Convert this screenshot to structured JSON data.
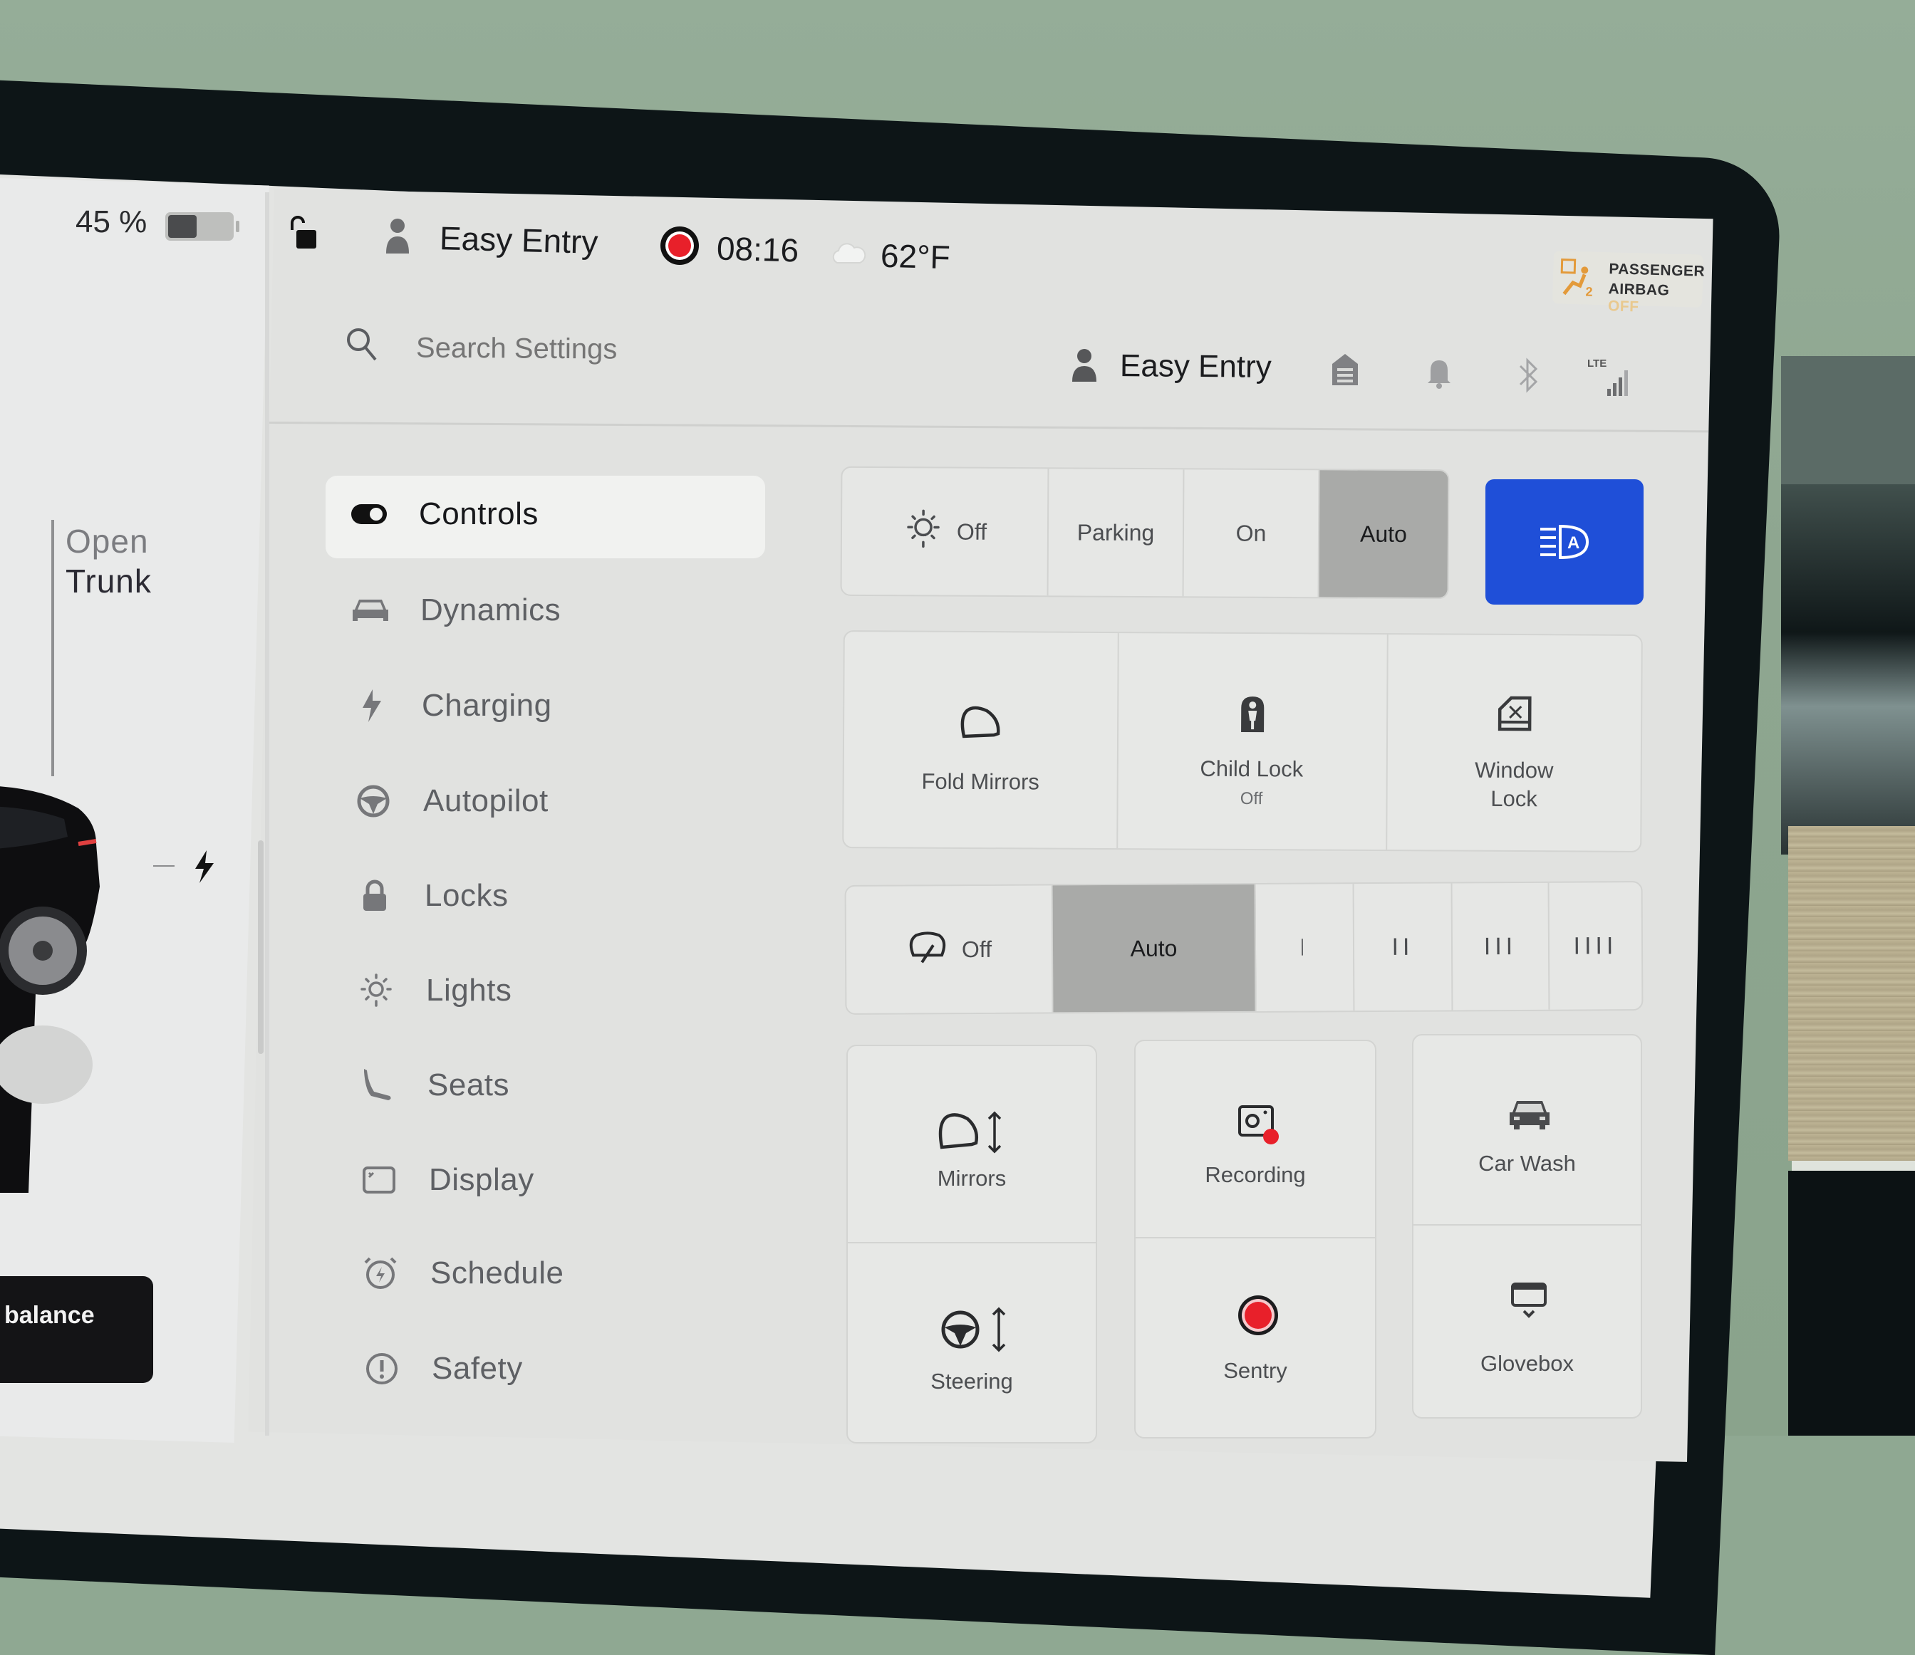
{
  "status_bar": {
    "battery_percent_label": "45 %",
    "battery_level": 0.45,
    "lock_state": "unlocked",
    "driver_profile": "Easy Entry",
    "recording_indicator": "recording",
    "time": "08:16",
    "weather_icon": "cloud-icon",
    "temperature": "62°F",
    "airbag_badge": {
      "line1": "PASSENGER",
      "line2": "AIRBAG",
      "state": "OFF"
    }
  },
  "car_panel": {
    "open_trunk_line1": "Open",
    "open_trunk_line2": "Trunk",
    "charge_port_icon": "lightning-icon",
    "toast_text": "balance"
  },
  "search": {
    "placeholder": "Search Settings"
  },
  "header_right": {
    "profile_name": "Easy Entry",
    "icons": [
      "garage-icon",
      "bell-icon",
      "bluetooth-icon",
      "lte-signal-icon"
    ],
    "lte_label": "LTE"
  },
  "sidebar": {
    "active": "Controls",
    "items": [
      {
        "label": "Controls",
        "icon": "toggle-icon"
      },
      {
        "label": "Dynamics",
        "icon": "car-icon"
      },
      {
        "label": "Charging",
        "icon": "lightning-icon"
      },
      {
        "label": "Autopilot",
        "icon": "steering-wheel-icon"
      },
      {
        "label": "Locks",
        "icon": "lock-icon"
      },
      {
        "label": "Lights",
        "icon": "bulb-icon"
      },
      {
        "label": "Seats",
        "icon": "seat-icon"
      },
      {
        "label": "Display",
        "icon": "display-icon"
      },
      {
        "label": "Schedule",
        "icon": "alarm-clock-icon"
      },
      {
        "label": "Safety",
        "icon": "alert-icon"
      }
    ]
  },
  "controls": {
    "headlights": {
      "options": [
        "Off",
        "Parking",
        "On",
        "Auto"
      ],
      "selected": "Auto",
      "auto_high_beam_color": "#1f4fd8"
    },
    "row2": [
      {
        "label": "Fold Mirrors",
        "sub": ""
      },
      {
        "label": "Child Lock",
        "sub": "Off"
      },
      {
        "label": "Window",
        "label2": "Lock"
      }
    ],
    "wipers": {
      "options": [
        "Off",
        "Auto",
        "I",
        "II",
        "III",
        "IIII"
      ],
      "selected": "Auto"
    },
    "grid": [
      {
        "label": "Mirrors",
        "icon": "mirror-adjust-icon"
      },
      {
        "label": "Recording",
        "icon": "dashcam-icon"
      },
      {
        "label": "Car Wash",
        "icon": "car-wash-icon"
      },
      {
        "label": "Steering",
        "icon": "steering-adjust-icon"
      },
      {
        "label": "Sentry",
        "icon": "sentry-icon"
      },
      {
        "label": "Glovebox",
        "icon": "glovebox-icon"
      }
    ]
  },
  "colors": {
    "accent_blue": "#1f4fd8",
    "record_red": "#e8202a",
    "airbag_orange": "#e39a3a"
  }
}
